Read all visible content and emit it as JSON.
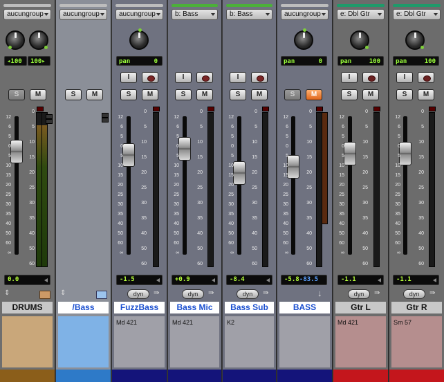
{
  "colors": {
    "accent": "#1a4fd0",
    "selected_strip": "#6f7280",
    "group_strip": "#8b8f98",
    "green_panel": "#9bff3b",
    "orange_mute": "#e0661a"
  },
  "strips": [
    {
      "id": "drums",
      "output": "aucungroup",
      "pan_l": "100",
      "pan_r": "100",
      "pan_label": "",
      "vol": "0.0",
      "name": "DRUMS",
      "comment": ""
    },
    {
      "id": "bass_folder",
      "output": "aucungroup",
      "name": "/Bass",
      "comment": ""
    },
    {
      "id": "fuzzbass",
      "output": "aucungroup",
      "pan_label": "pan",
      "pan_val": "0",
      "vol": "-1.5",
      "dyn": "dyn",
      "name": "FuzzBass",
      "comment": "Md 421"
    },
    {
      "id": "bassmic",
      "output": "b: Bass",
      "pan_label": "",
      "vol": "+0.9",
      "dyn": "dyn",
      "name": "Bass Mic",
      "comment": "Md 421"
    },
    {
      "id": "basssub",
      "output": "b: Bass",
      "pan_label": "",
      "vol": "-8.4",
      "dyn": "dyn",
      "name": "Bass Sub",
      "comment": "K2"
    },
    {
      "id": "bass",
      "output": "aucungroup",
      "pan_label": "pan",
      "pan_val": "0",
      "vol": "-5.8",
      "peak": "-83.5",
      "name": "BASS",
      "comment": ""
    },
    {
      "id": "gtrl",
      "output": "e: Dbl Gtr",
      "pan_label": "pan",
      "pan_val": "100",
      "vol": "-1.1",
      "dyn": "dyn",
      "name": "Gtr L",
      "comment": "Md 421"
    },
    {
      "id": "gtrr",
      "output": "e: Dbl Gtr",
      "pan_label": "pan",
      "pan_val": "100",
      "vol": "-1.1",
      "dyn": "dyn",
      "name": "Gtr R",
      "comment": "Sm 57"
    }
  ],
  "buttons": {
    "solo": "S",
    "mute": "M",
    "input": "I"
  },
  "scale_left": [
    "12",
    "6",
    "5",
    "0",
    "5",
    "10",
    "15",
    "20",
    "25",
    "30",
    "35",
    "40",
    "50",
    "60",
    "∞"
  ],
  "scale_right": [
    "0",
    "5",
    "10",
    "15",
    "20",
    "25",
    "30",
    "35",
    "40",
    "50",
    "60"
  ],
  "icons": {
    "fast_forward": "⇛",
    "down_arrow": "↓",
    "up_down": "⇕"
  }
}
